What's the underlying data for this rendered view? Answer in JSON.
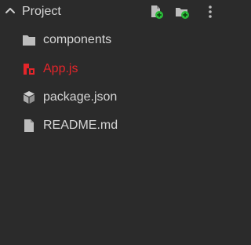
{
  "explorer": {
    "title": "Project",
    "actions": {
      "new_file_icon": "file-plus-icon",
      "new_folder_icon": "folder-plus-icon",
      "more_icon": "more-vertical-icon"
    },
    "items": [
      {
        "label": "components",
        "icon": "folder-icon",
        "status": "normal"
      },
      {
        "label": "App.js",
        "icon": "react-js-file-icon",
        "status": "error"
      },
      {
        "label": "package.json",
        "icon": "package-icon",
        "status": "normal"
      },
      {
        "label": "README.md",
        "icon": "document-icon",
        "status": "normal"
      }
    ]
  },
  "colors": {
    "background": "#2b2b2b",
    "text": "#d6d6d6",
    "icon": "#bdbdbd",
    "error": "#e5252a",
    "add_badge": "#2bbd3a"
  }
}
